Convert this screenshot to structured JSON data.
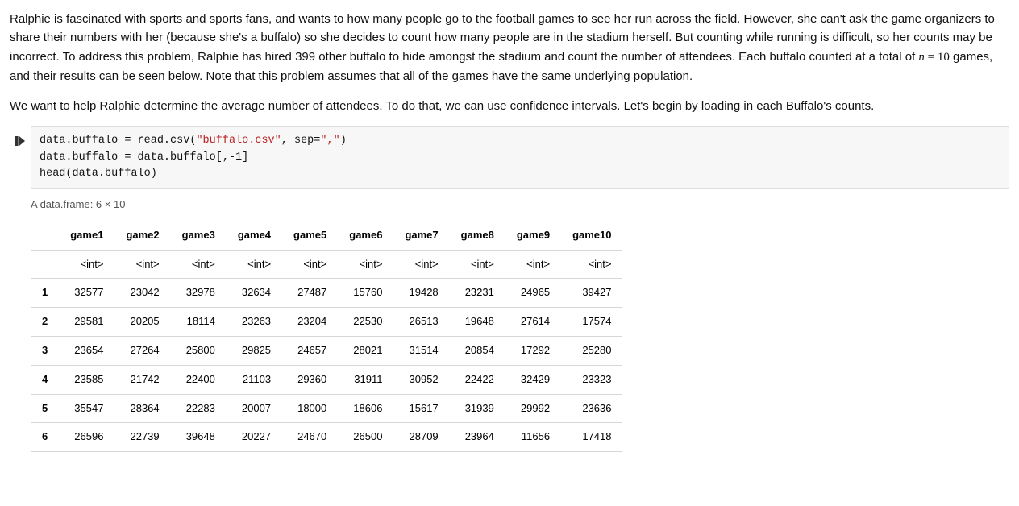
{
  "prose": {
    "p1_pre_n": "Ralphie is fascinated with sports and sports fans, and wants to how many people go to the football games to see her run across the field. However, she can't ask the game organizers to share their numbers with her (because she's a buffalo) so she decides to count how many people are in the stadium herself. But counting while running is difficult, so her counts may be incorrect. To address this problem, Ralphie has hired 399 other buffalo to hide amongst the stadium and count the number of attendees. Each buffalo counted at a total of ",
    "n_var": "n",
    "eq": " = ",
    "n_val": "10",
    "p1_post_n": " games, and their results can be seen below. Note that this problem assumes that all of the games have the same underlying population.",
    "p2": "We want to help Ralphie determine the average number of attendees. To do that, we can use confidence intervals. Let's begin by loading in each Buffalo's counts."
  },
  "code": {
    "line1a": "data.buffalo = read.csv(",
    "line1b": "\"buffalo.csv\"",
    "line1c": ", sep=",
    "line1d": "\",\"",
    "line1e": ")",
    "line2": "data.buffalo = data.buffalo[,-1]",
    "line3": "head(data.buffalo)"
  },
  "output": {
    "caption": "A data.frame: 6 × 10",
    "columns": [
      "game1",
      "game2",
      "game3",
      "game4",
      "game5",
      "game6",
      "game7",
      "game8",
      "game9",
      "game10"
    ],
    "dtype": "<int>",
    "rows": [
      {
        "idx": "1",
        "vals": [
          "32577",
          "23042",
          "32978",
          "32634",
          "27487",
          "15760",
          "19428",
          "23231",
          "24965",
          "39427"
        ]
      },
      {
        "idx": "2",
        "vals": [
          "29581",
          "20205",
          "18114",
          "23263",
          "23204",
          "22530",
          "26513",
          "19648",
          "27614",
          "17574"
        ]
      },
      {
        "idx": "3",
        "vals": [
          "23654",
          "27264",
          "25800",
          "29825",
          "24657",
          "28021",
          "31514",
          "20854",
          "17292",
          "25280"
        ]
      },
      {
        "idx": "4",
        "vals": [
          "23585",
          "21742",
          "22400",
          "21103",
          "29360",
          "31911",
          "30952",
          "22422",
          "32429",
          "23323"
        ]
      },
      {
        "idx": "5",
        "vals": [
          "35547",
          "28364",
          "22283",
          "20007",
          "18000",
          "18606",
          "15617",
          "31939",
          "29992",
          "23636"
        ]
      },
      {
        "idx": "6",
        "vals": [
          "26596",
          "22739",
          "39648",
          "20227",
          "24670",
          "26500",
          "28709",
          "23964",
          "11656",
          "17418"
        ]
      }
    ]
  },
  "chart_data": {
    "type": "table",
    "title": "A data.frame: 6 × 10",
    "columns": [
      "game1",
      "game2",
      "game3",
      "game4",
      "game5",
      "game6",
      "game7",
      "game8",
      "game9",
      "game10"
    ],
    "data": [
      [
        32577,
        23042,
        32978,
        32634,
        27487,
        15760,
        19428,
        23231,
        24965,
        39427
      ],
      [
        29581,
        20205,
        18114,
        23263,
        23204,
        22530,
        26513,
        19648,
        27614,
        17574
      ],
      [
        23654,
        27264,
        25800,
        29825,
        24657,
        28021,
        31514,
        20854,
        17292,
        25280
      ],
      [
        23585,
        21742,
        22400,
        21103,
        29360,
        31911,
        30952,
        22422,
        32429,
        23323
      ],
      [
        35547,
        28364,
        22283,
        20007,
        18000,
        18606,
        15617,
        31939,
        29992,
        23636
      ],
      [
        26596,
        22739,
        39648,
        20227,
        24670,
        26500,
        28709,
        23964,
        11656,
        17418
      ]
    ]
  }
}
